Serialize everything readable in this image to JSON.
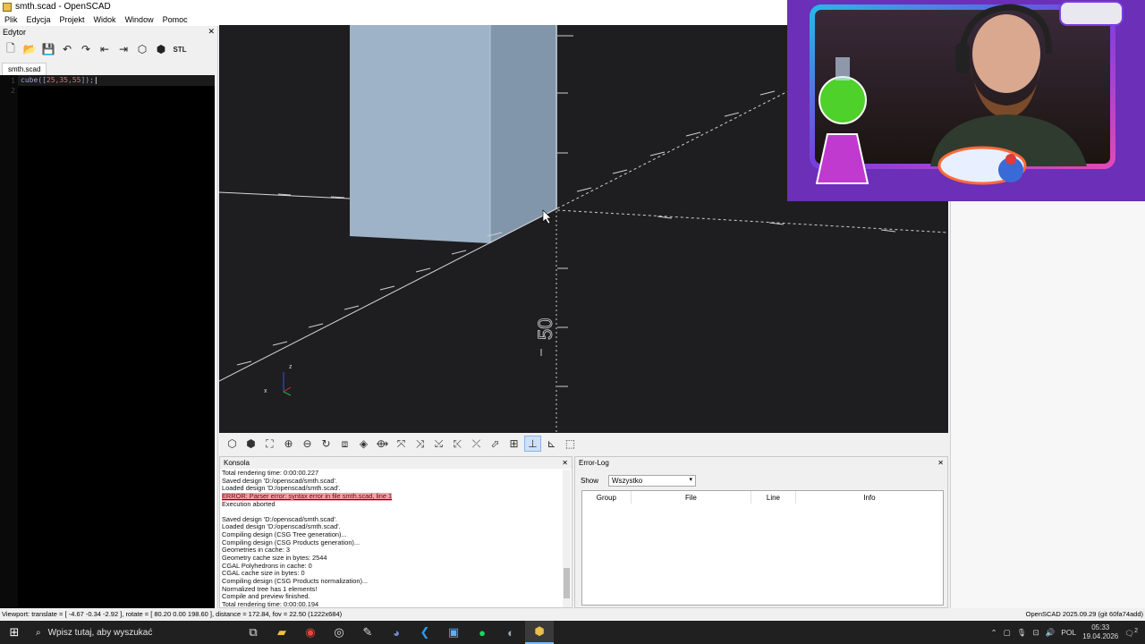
{
  "window": {
    "title": "smth.scad - OpenSCAD"
  },
  "menu": [
    "Plik",
    "Edycja",
    "Projekt",
    "Widok",
    "Window",
    "Pomoc"
  ],
  "editor": {
    "panel_title": "Edytor",
    "tab": "smth.scad",
    "line_numbers": [
      "1",
      "2"
    ],
    "code_fn": "cube([",
    "code_args": "25,35,55",
    "code_end": "]);"
  },
  "viewport": {
    "axis_label": "50",
    "axis_z": "z",
    "axis_x": "x"
  },
  "console": {
    "title": "Konsola",
    "lines": [
      "Total rendering time: 0:00:00.227",
      "Saved design 'D:/openscad/smth.scad'.",
      "Loaded design 'D:/openscad/smth.scad'.",
      "ERROR: Parser error: syntax error in file smth.scad, line 1",
      "Execution aborted",
      "",
      "Saved design 'D:/openscad/smth.scad'.",
      "Loaded design 'D:/openscad/smth.scad'.",
      "Compiling design (CSG Tree generation)...",
      "Compiling design (CSG Products generation)...",
      "Geometries in cache: 3",
      "Geometry cache size in bytes: 2544",
      "CGAL Polyhedrons in cache: 0",
      "CGAL cache size in bytes: 0",
      "Compiling design (CSG Products normalization)...",
      "Normalized tree has 1 elements!",
      "Compile and preview finished.",
      "Total rendering time: 0:00:00.194"
    ]
  },
  "errorlog": {
    "title": "Error-Log",
    "show_label": "Show",
    "filter": "Wszystko",
    "columns": [
      "Group",
      "File",
      "Line",
      "Info"
    ]
  },
  "statusbar": {
    "left": "Viewport: translate = [ -4.67 -0.34 -2.92 ], rotate = [ 80.20 0.00 198.60 ], distance = 172.84, fov = 22.50 (1222x684)",
    "right": "OpenSCAD 2025.09.29 (git 60fa74add)"
  },
  "taskbar": {
    "search_placeholder": "Wpisz tutaj, aby wyszukać",
    "lang": "POL",
    "time": "05:33",
    "date": "19.04.2026",
    "notif_count": "2"
  },
  "colors": {
    "viewport_bg": "#1e1e20",
    "cube_front": "#9fb3c8",
    "cube_side": "#7f93a8",
    "error_bg": "#f5a0a8"
  }
}
